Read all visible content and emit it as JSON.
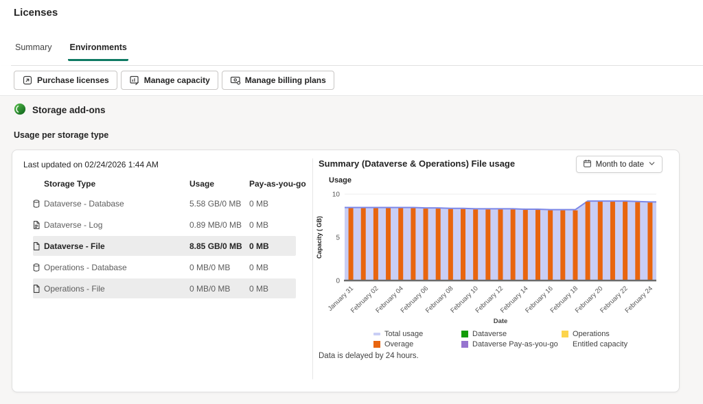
{
  "page": {
    "title": "Licenses"
  },
  "tabs": [
    {
      "label": "Summary",
      "active": false
    },
    {
      "label": "Environments",
      "active": true
    }
  ],
  "accent_color": "#0e7a63",
  "toolbar": {
    "buttons": [
      {
        "label": "Purchase licenses",
        "icon": "purchase-licenses-icon"
      },
      {
        "label": "Manage capacity",
        "icon": "manage-capacity-icon"
      },
      {
        "label": "Manage billing plans",
        "icon": "manage-billing-plans-icon"
      }
    ]
  },
  "section": {
    "title": "Storage add-ons",
    "subtitle": "Usage per storage type"
  },
  "usage_table": {
    "last_updated": "Last updated on 02/24/2026 1:44 AM",
    "columns": [
      "Storage Type",
      "Usage",
      "Pay-as-you-go"
    ],
    "rows": [
      {
        "icon": "database-icon",
        "name": "Dataverse - Database",
        "usage": "5.58 GB/0 MB",
        "payg": "0 MB",
        "selected": false,
        "emphasized": false
      },
      {
        "icon": "log-icon",
        "name": "Dataverse - Log",
        "usage": "0.89 MB/0 MB",
        "payg": "0 MB",
        "selected": false,
        "emphasized": false
      },
      {
        "icon": "file-icon",
        "name": "Dataverse - File",
        "usage": "8.85 GB/0 MB",
        "payg": "0 MB",
        "selected": true,
        "emphasized": true
      },
      {
        "icon": "database-icon",
        "name": "Operations - Database",
        "usage": "0 MB/0 MB",
        "payg": "0 MB",
        "selected": false,
        "emphasized": false
      },
      {
        "icon": "file-icon",
        "name": "Operations - File",
        "usage": "0 MB/0 MB",
        "payg": "0 MB",
        "selected": true,
        "emphasized": false
      }
    ]
  },
  "chart_panel": {
    "title": "Summary (Dataverse & Operations) File usage",
    "range_selector": "Month to date",
    "footnote": "Data is delayed by 24 hours."
  },
  "chart_data": {
    "type": "bar",
    "title": "Summary (Dataverse & Operations) File usage",
    "corner_label": "Usage",
    "xlabel": "Date",
    "ylabel": "Capacity ( GB)",
    "ylim": [
      0,
      10
    ],
    "yticks": [
      0,
      5,
      10
    ],
    "grid": true,
    "legend_position": "bottom",
    "x": [
      "January 31",
      "February 01",
      "February 02",
      "February 03",
      "February 04",
      "February 05",
      "February 06",
      "February 07",
      "February 08",
      "February 09",
      "February 10",
      "February 11",
      "February 12",
      "February 13",
      "February 14",
      "February 15",
      "February 16",
      "February 17",
      "February 18",
      "February 19",
      "February 20",
      "February 21",
      "February 22",
      "February 23",
      "February 24"
    ],
    "x_tick_every": 2,
    "series": [
      {
        "name": "Total usage",
        "style": "area",
        "fill": "#c9cef5",
        "stroke": "#7b87e8",
        "values": [
          8.45,
          8.45,
          8.45,
          8.45,
          8.45,
          8.45,
          8.4,
          8.4,
          8.35,
          8.35,
          8.3,
          8.3,
          8.3,
          8.3,
          8.25,
          8.25,
          8.2,
          8.2,
          8.2,
          9.2,
          9.2,
          9.2,
          9.2,
          9.15,
          9.1
        ]
      },
      {
        "name": "Overage",
        "style": "bar",
        "fill": "#e8650f",
        "values": [
          8.45,
          8.45,
          8.45,
          8.45,
          8.45,
          8.45,
          8.4,
          8.4,
          8.35,
          8.35,
          8.3,
          8.3,
          8.3,
          8.3,
          8.25,
          8.25,
          8.2,
          8.2,
          8.2,
          9.2,
          9.2,
          9.2,
          9.2,
          9.15,
          9.1
        ]
      }
    ],
    "legend": [
      {
        "label": "Total usage",
        "color": "#c9cef5",
        "swatch": "line"
      },
      {
        "label": "Dataverse",
        "color": "#129c08",
        "swatch": "square"
      },
      {
        "label": "Operations",
        "color": "#fcd44c",
        "swatch": "square"
      },
      {
        "label": "Overage",
        "color": "#e8650f",
        "swatch": "square"
      },
      {
        "label": "Dataverse Pay-as-you-go",
        "color": "#9674cf",
        "swatch": "square"
      },
      {
        "label": "Entitled capacity",
        "color": "transparent",
        "swatch": "none"
      }
    ]
  }
}
